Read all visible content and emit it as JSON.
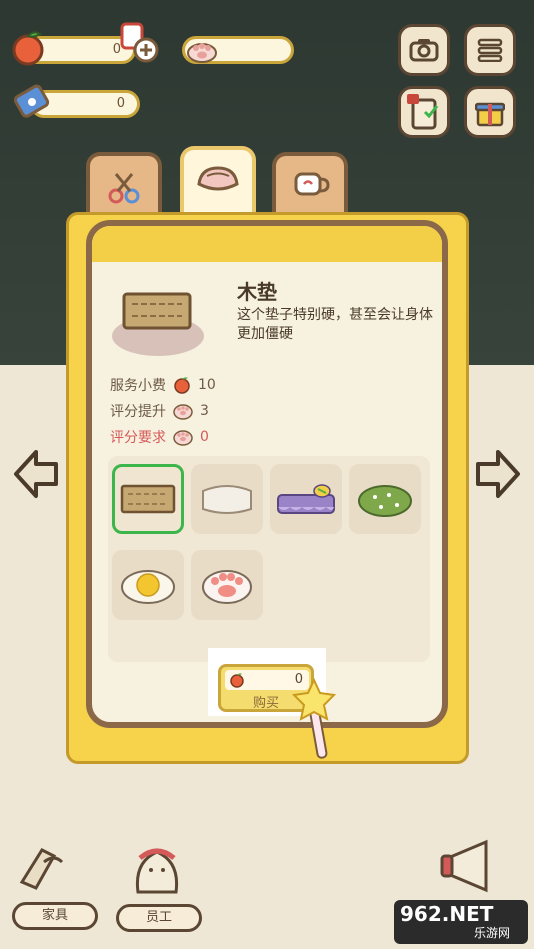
{
  "hud": {
    "apple_count": "0",
    "paw_count": "",
    "ticket_count": "0"
  },
  "item": {
    "name": "木垫",
    "description": "这个垫子特别硬，甚至会让身体更加僵硬",
    "stats": [
      {
        "label": "服务小费",
        "icon": "apple-icon",
        "value": "10"
      },
      {
        "label": "评分提升",
        "icon": "paw-icon",
        "value": "3"
      },
      {
        "label": "评分要求",
        "icon": "paw-icon",
        "value": "0"
      }
    ]
  },
  "slots": [
    {
      "name": "wooden-mat",
      "icon": "wooden-mat-icon"
    },
    {
      "name": "white-cushion",
      "icon": "white-cushion-icon"
    },
    {
      "name": "purple-bed",
      "icon": "purple-bed-icon"
    },
    {
      "name": "grass-mat",
      "icon": "grass-mat-icon"
    },
    {
      "name": "egg-cushion",
      "icon": "egg-cushion-icon"
    },
    {
      "name": "paw-cushion",
      "icon": "paw-cushion-icon"
    }
  ],
  "buy": {
    "price": "0",
    "label": "购买"
  },
  "bottom": {
    "furniture_label": "家具",
    "staff_label": "员工"
  },
  "watermark": {
    "main": "962.NET",
    "sub": "乐游网"
  },
  "colors": {
    "panel_yellow": "#f6d34a",
    "selected_border": "#3cb54a",
    "requirement_red": "#d45a5a"
  }
}
